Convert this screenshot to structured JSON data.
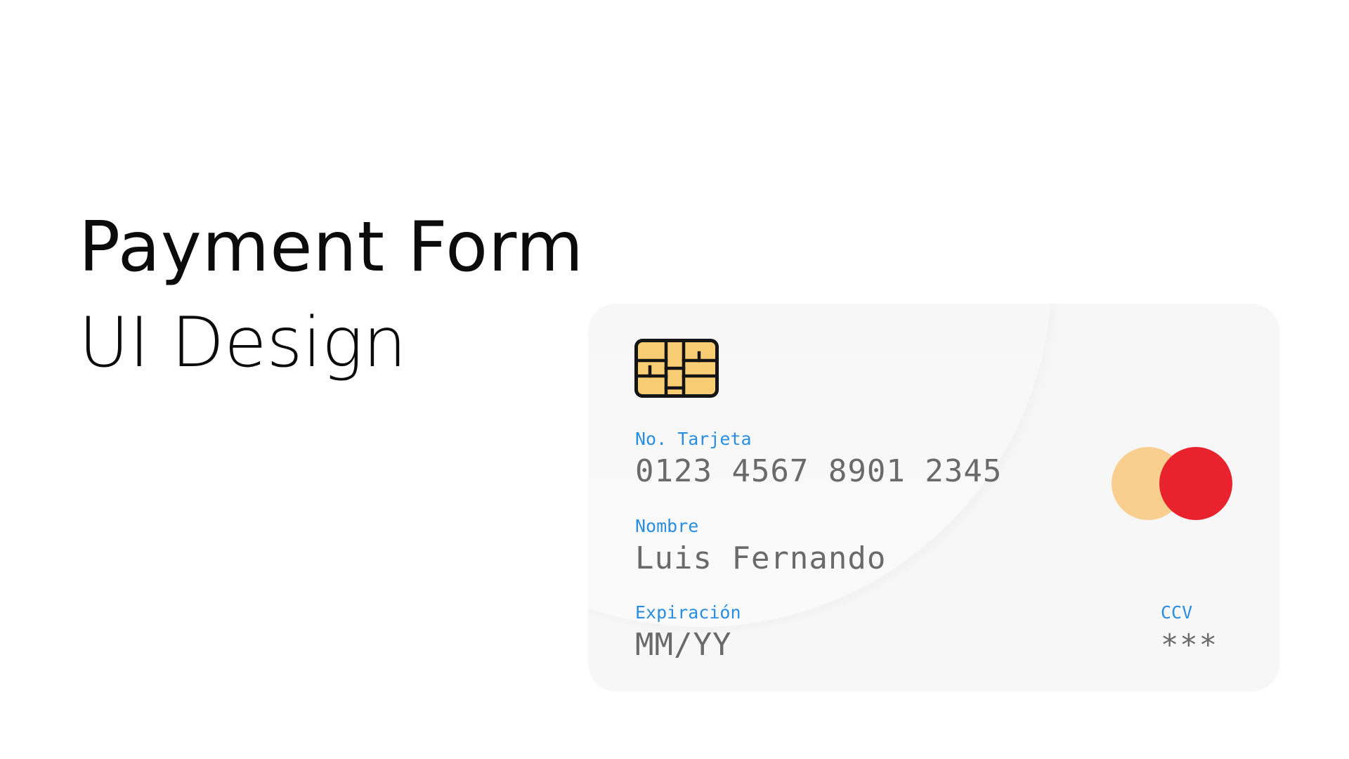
{
  "hero": {
    "title": "Payment Form",
    "subtitle": "UI Design"
  },
  "card": {
    "chip_icon": "card-chip-icon",
    "number": {
      "label": "No. Tarjeta",
      "value": "0123 4567 8901 2345"
    },
    "name": {
      "label": "Nombre",
      "value": "Luis Fernando"
    },
    "expiration": {
      "label": "Expiración",
      "value": "MM/YY"
    },
    "ccv": {
      "label": "CCV",
      "value": "***"
    },
    "brand_logo": {
      "icon": "card-brand-logo",
      "colors": {
        "left": "#f9cf90",
        "right": "#e8232d"
      }
    }
  },
  "colors": {
    "label": "#2a8ee0",
    "value": "#6a6a6a",
    "chip_fill": "#f8cd73",
    "chip_stroke": "#141414",
    "card_background": "#f7f7f7"
  }
}
